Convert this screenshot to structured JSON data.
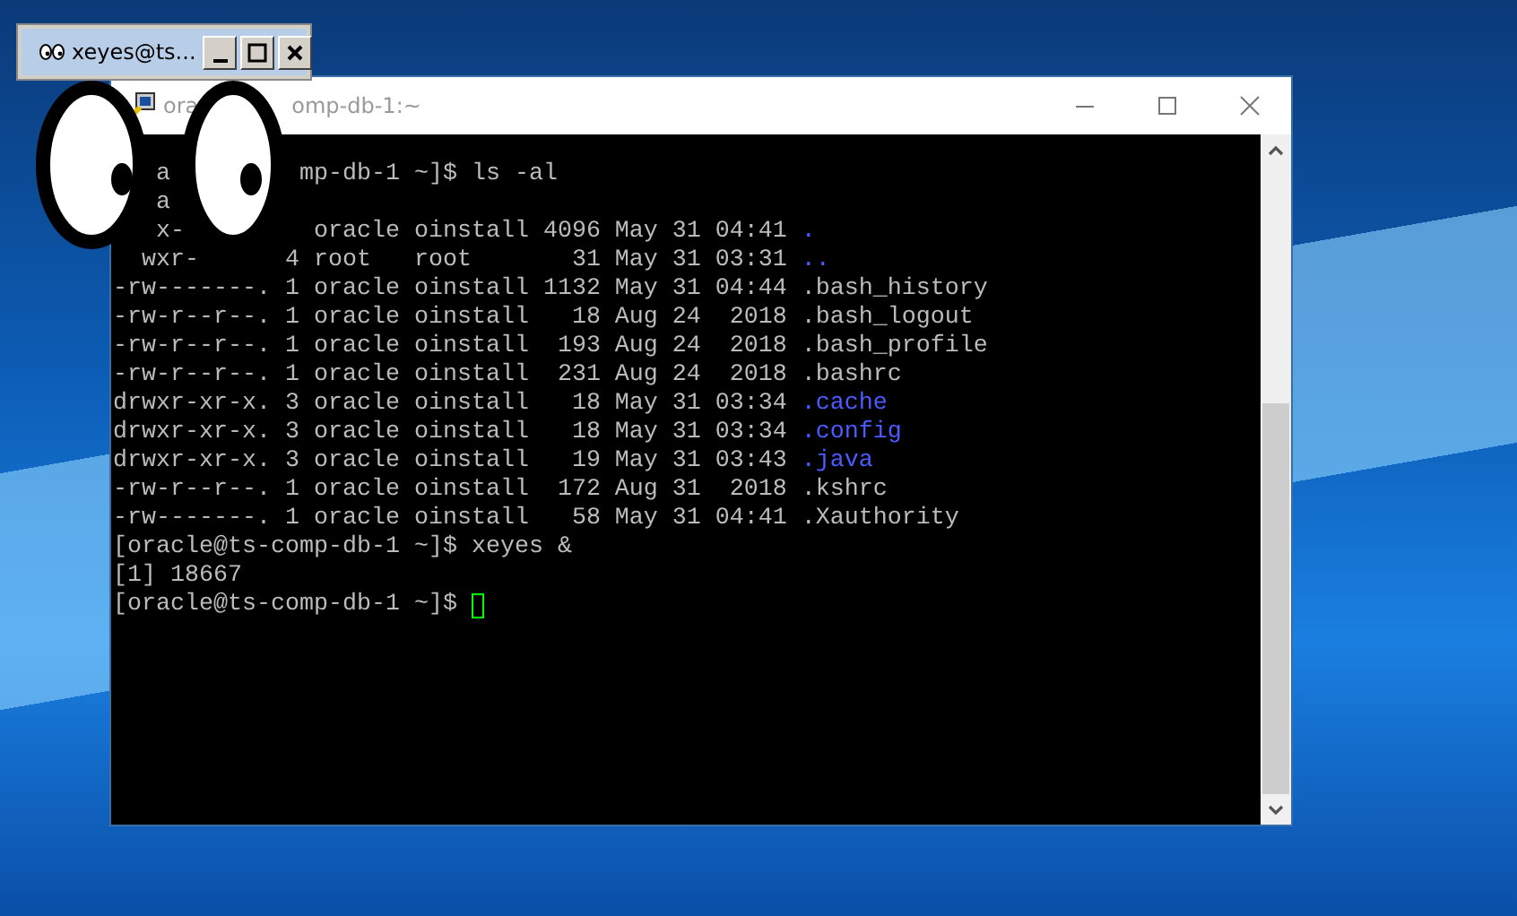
{
  "xeyes_window": {
    "title": "xeyes@ts..."
  },
  "terminal_window": {
    "title_parts": [
      "ora",
      "omp-db-1:~"
    ],
    "lines": [
      {
        "kind": "prompt",
        "text": "   a         mp-db-1 ~]$ ls -al"
      },
      {
        "kind": "text",
        "text": "   a"
      },
      {
        "kind": "dir",
        "text": "   x-         oracle oinstall 4096 May 31 04:41 ",
        "name": "."
      },
      {
        "kind": "dir",
        "text": "  wxr-      4 root   root       31 May 31 03:31 ",
        "name": ".."
      },
      {
        "kind": "file",
        "text": "-rw-------. 1 oracle oinstall 1132 May 31 04:44 ",
        "name": ".bash_history"
      },
      {
        "kind": "file",
        "text": "-rw-r--r--. 1 oracle oinstall   18 Aug 24  2018 ",
        "name": ".bash_logout"
      },
      {
        "kind": "file",
        "text": "-rw-r--r--. 1 oracle oinstall  193 Aug 24  2018 ",
        "name": ".bash_profile"
      },
      {
        "kind": "file",
        "text": "-rw-r--r--. 1 oracle oinstall  231 Aug 24  2018 ",
        "name": ".bashrc"
      },
      {
        "kind": "dir",
        "text": "drwxr-xr-x. 3 oracle oinstall   18 May 31 03:34 ",
        "name": ".cache"
      },
      {
        "kind": "dir",
        "text": "drwxr-xr-x. 3 oracle oinstall   18 May 31 03:34 ",
        "name": ".config"
      },
      {
        "kind": "dir",
        "text": "drwxr-xr-x. 3 oracle oinstall   19 May 31 03:43 ",
        "name": ".java"
      },
      {
        "kind": "file",
        "text": "-rw-r--r--. 1 oracle oinstall  172 Aug 31  2018 ",
        "name": ".kshrc"
      },
      {
        "kind": "file",
        "text": "-rw-------. 1 oracle oinstall   58 May 31 04:41 ",
        "name": ".Xauthority"
      },
      {
        "kind": "prompt",
        "text": "[oracle@ts-comp-db-1 ~]$ xeyes &"
      },
      {
        "kind": "text",
        "text": "[1] 18667"
      },
      {
        "kind": "prompt",
        "text": "[oracle@ts-comp-db-1 ~]$ ",
        "cursor": true
      }
    ]
  }
}
